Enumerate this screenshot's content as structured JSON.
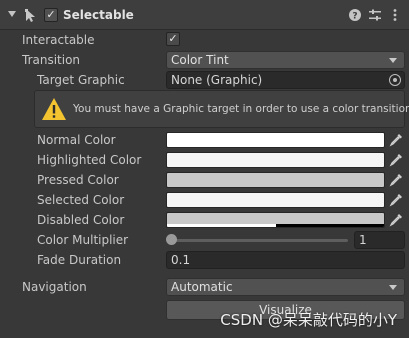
{
  "header": {
    "title": "Selectable",
    "enabled_mark": "✓",
    "icons": [
      "fold-arrow-icon",
      "component-icon",
      "help-icon",
      "preset-icon",
      "more-options-icon"
    ]
  },
  "interactable": {
    "label": "Interactable",
    "check": "✓"
  },
  "transition": {
    "label": "Transition",
    "value": "Color Tint"
  },
  "target_graphic": {
    "label": "Target Graphic",
    "value": "None (Graphic)"
  },
  "help": {
    "message": "You must have a Graphic target in order to use a color transition."
  },
  "colors": [
    {
      "label": "Normal Color",
      "swatch": "#ffffff",
      "alpha": 1.0
    },
    {
      "label": "Highlighted Color",
      "swatch": "#f5f5f5",
      "alpha": 1.0
    },
    {
      "label": "Pressed Color",
      "swatch": "#c8c8c8",
      "alpha": 1.0
    },
    {
      "label": "Selected Color",
      "swatch": "#f5f5f5",
      "alpha": 1.0
    },
    {
      "label": "Disabled Color",
      "swatch": "#c8c8c8",
      "alpha": 0.5
    }
  ],
  "color_multiplier": {
    "label": "Color Multiplier",
    "value": "1"
  },
  "fade_duration": {
    "label": "Fade Duration",
    "value": "0.1"
  },
  "navigation": {
    "label": "Navigation",
    "value": "Automatic"
  },
  "visualize": {
    "label": "Visualize"
  },
  "watermark": "CSDN @呆呆敲代码的小Y",
  "theme": {
    "background": "#383838",
    "warning": "#f4c430"
  }
}
